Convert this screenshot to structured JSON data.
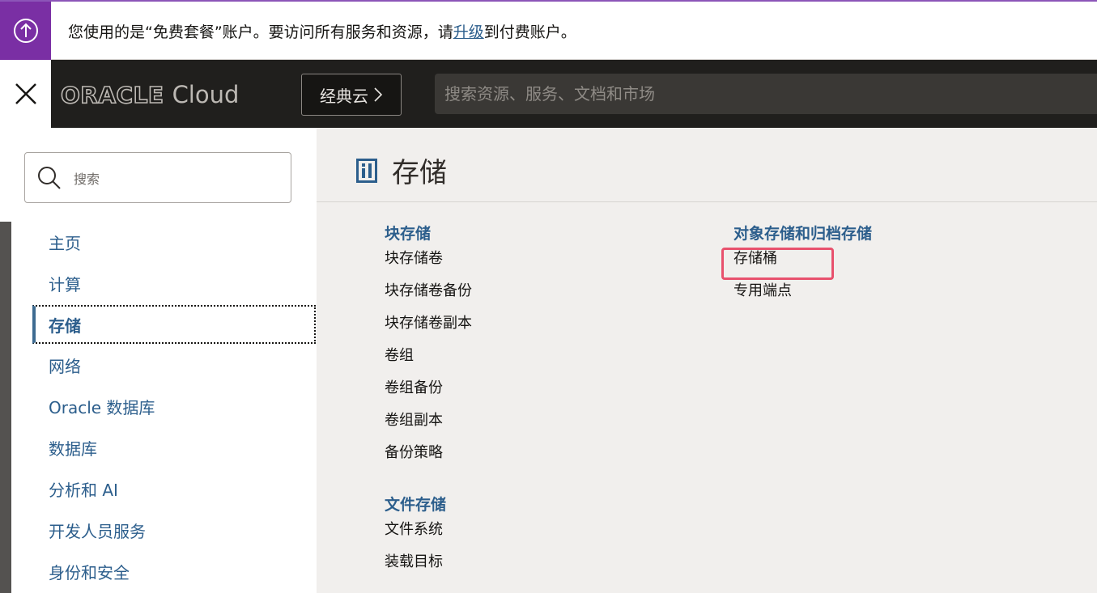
{
  "banner": {
    "text_before": "您使用的是“免费套餐”账户。要访问所有服务和资源，请",
    "link": "升级",
    "text_after": "到付费账户。",
    "icon": "upgrade-arrow-icon"
  },
  "header": {
    "logo_brand": "ORACLE",
    "logo_product": "Cloud",
    "classic_label": "经典云",
    "search_placeholder": "搜索资源、服务、文档和市场"
  },
  "sidebar": {
    "search_placeholder": "搜索",
    "items": [
      {
        "label": "主页"
      },
      {
        "label": "计算"
      },
      {
        "label": "存储",
        "active": true
      },
      {
        "label": "网络"
      },
      {
        "label": "Oracle 数据库"
      },
      {
        "label": "数据库"
      },
      {
        "label": "分析和 AI"
      },
      {
        "label": "开发人员服务"
      },
      {
        "label": "身份和安全"
      }
    ]
  },
  "main": {
    "title": "存储",
    "title_icon": "storage-icon",
    "block_storage": {
      "heading": "块存储",
      "links": [
        "块存储卷",
        "块存储卷备份",
        "块存储卷副本",
        "卷组",
        "卷组备份",
        "卷组副本",
        "备份策略"
      ]
    },
    "file_storage": {
      "heading": "文件存储",
      "links": [
        "文件系统",
        "装载目标"
      ]
    },
    "object_storage": {
      "heading": "对象存储和归档存储",
      "links": [
        "存储桶",
        "专用端点"
      ]
    }
  },
  "colors": {
    "banner_accent": "#7a2fa4",
    "link_blue": "#2c5e8c",
    "header_dark": "#201f1d",
    "highlight": "#e8516d"
  }
}
